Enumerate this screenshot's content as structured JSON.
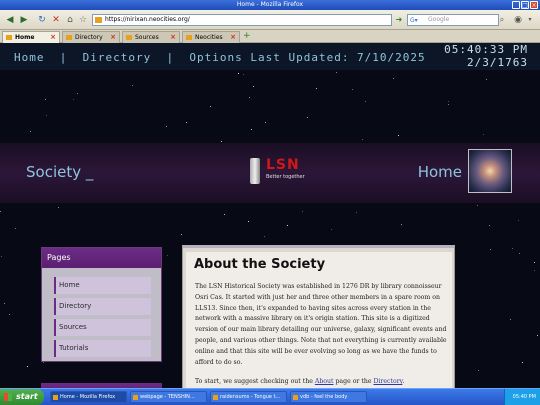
{
  "window": {
    "title": "Home - Mozilla Firefox"
  },
  "browser": {
    "url": "https://nirixan.neocities.org/",
    "search_placeholder": "Google",
    "tabs": [
      {
        "label": "Home"
      },
      {
        "label": "Directory"
      },
      {
        "label": "Sources"
      },
      {
        "label": "Neocities"
      }
    ],
    "new_tab": "+"
  },
  "site": {
    "nav": {
      "home": "Home",
      "directory": "Directory",
      "options": "Options",
      "sep": "|"
    },
    "last_updated": "Last Updated: 7/10/2025",
    "clock_time": "05:40:33 PM",
    "clock_date": "2/3/1763",
    "band_title": "Society _",
    "band_home": "Home",
    "logo_text": "LSN",
    "logo_tagline": "Better together",
    "sidebar": {
      "title": "Pages",
      "items": [
        "Home",
        "Directory",
        "Sources",
        "Tutorials"
      ]
    },
    "content": {
      "title": "About the Society",
      "paragraph1": "The LSN Historical Society was established in 1276 DR by library connoisseur Osri Cas. It started with just her and three other members in a spare room on LLS13. Since then, it's expanded to having sites across every station in the network with a massive library on it's origin station. This site is a digitized version of our main library detailing our universe, galaxy, significant events and people, and various other things. Note that not everything is currently available online and that this site will be ever evolving so long as we have the funds to afford to do so.",
      "p2_before": "To start, we suggest checking out the ",
      "p2_link1": "About",
      "p2_mid": " page or the ",
      "p2_link2": "Directory",
      "p2_end": "."
    }
  },
  "taskbar": {
    "start": "start",
    "tasks": [
      "Home - Mozilla Firefox",
      "webpage - TENSHIN...",
      "raidensums - Tongue t...",
      "vdb - feel the body"
    ],
    "tray_time": "05:40 PM"
  }
}
